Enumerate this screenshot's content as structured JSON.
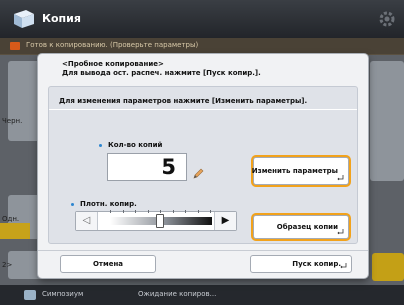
{
  "app": {
    "title": "Копия",
    "status_message": "Готов к копированию. (Проверьте параметры)",
    "bottom_left": "Симпозиум",
    "bottom_right": "Ожидание копиров..."
  },
  "background": {
    "label_left": "Черн.",
    "label_row": "Одн.",
    "label_b": "2>"
  },
  "dialog": {
    "header_line1": "<Пробное копирование>",
    "header_line2": "Для вывода ост. распеч. нажмите [Пуск копир.].",
    "panel_title": "Для изменения параметров нажмите [Изменить параметры].",
    "copies_label": "Кол-во копий",
    "copies_value": "5",
    "density_label": "Плотн. копир.",
    "slider": {
      "level": 0.5,
      "left_glyph": "◁",
      "right_glyph": "▶"
    },
    "change_settings_label": "Изменить параметры",
    "sample_copy_label": "Образец копии",
    "cancel_label": "Отмена",
    "start_label": "Пуск копир."
  },
  "colors": {
    "accent": "#f2a21b",
    "bullet": "#2e86d0"
  }
}
